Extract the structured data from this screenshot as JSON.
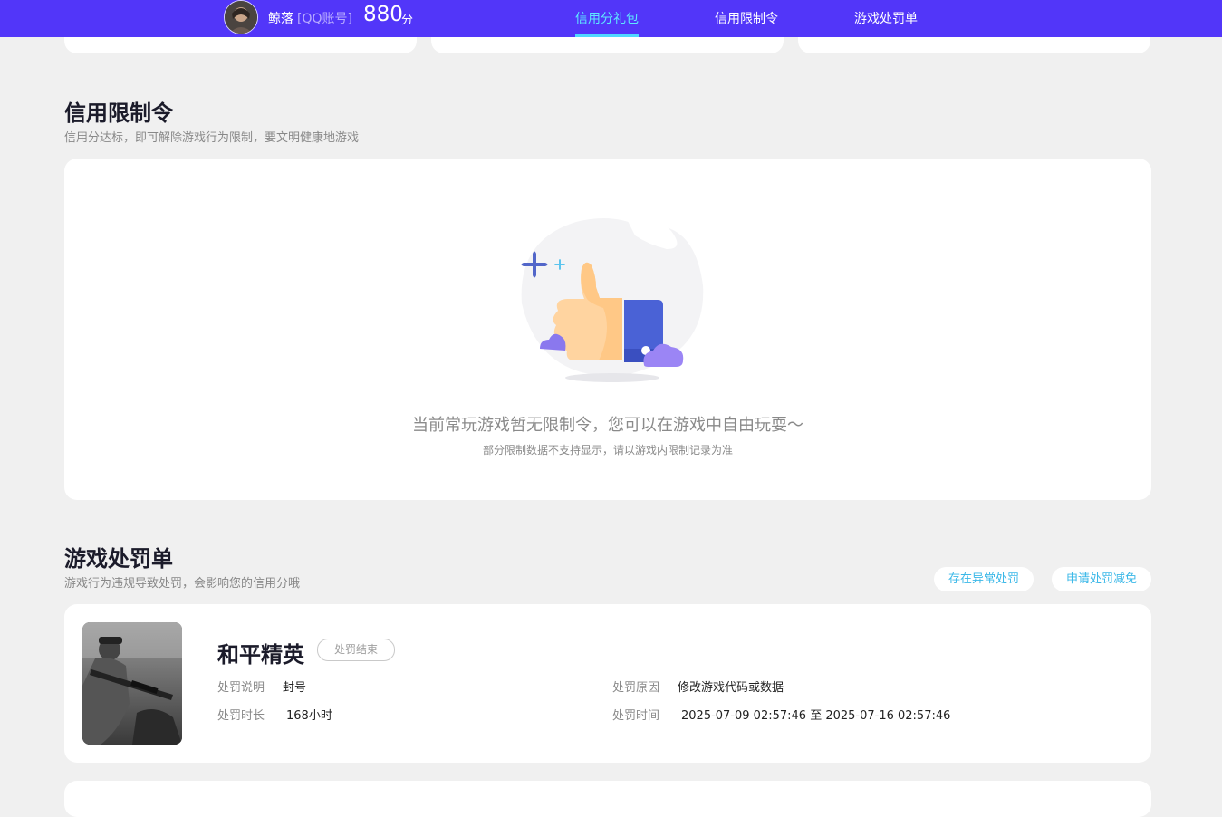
{
  "header": {
    "username": "鲸落",
    "account_type": "[QQ账号]",
    "score": "880",
    "score_unit": "分",
    "tabs": [
      {
        "label": "信用分礼包",
        "active": true
      },
      {
        "label": "信用限制令",
        "active": false
      },
      {
        "label": "游戏处罚单",
        "active": false
      }
    ]
  },
  "restriction": {
    "title": "信用限制令",
    "subtitle": "信用分达标，即可解除游戏行为限制，要文明健康地游戏",
    "empty_message": "当前常玩游戏暂无限制令，您可以在游戏中自由玩耍～",
    "empty_note": "部分限制数据不支持显示，请以游戏内限制记录为准"
  },
  "penalty": {
    "title": "游戏处罚单",
    "subtitle": "游戏行为违规导致处罚，会影响您的信用分哦",
    "report_button": "存在异常处罚",
    "appeal_button": "申请处罚减免",
    "records": [
      {
        "game": "和平精英",
        "status": "处罚结束",
        "desc_label": "处罚说明",
        "desc_value": "封号",
        "reason_label": "处罚原因",
        "reason_value": "修改游戏代码或数据",
        "duration_label": "处罚时长",
        "duration_value": "168小时",
        "time_label": "处罚时间",
        "time_value": "2025-07-09 02:57:46 至 2025-07-16 02:57:46"
      }
    ]
  },
  "colors": {
    "header_bg": "#5236f9",
    "active_tab": "#5ee8ff",
    "link": "#3bb8e8",
    "page_bg": "#f0f0f0"
  }
}
